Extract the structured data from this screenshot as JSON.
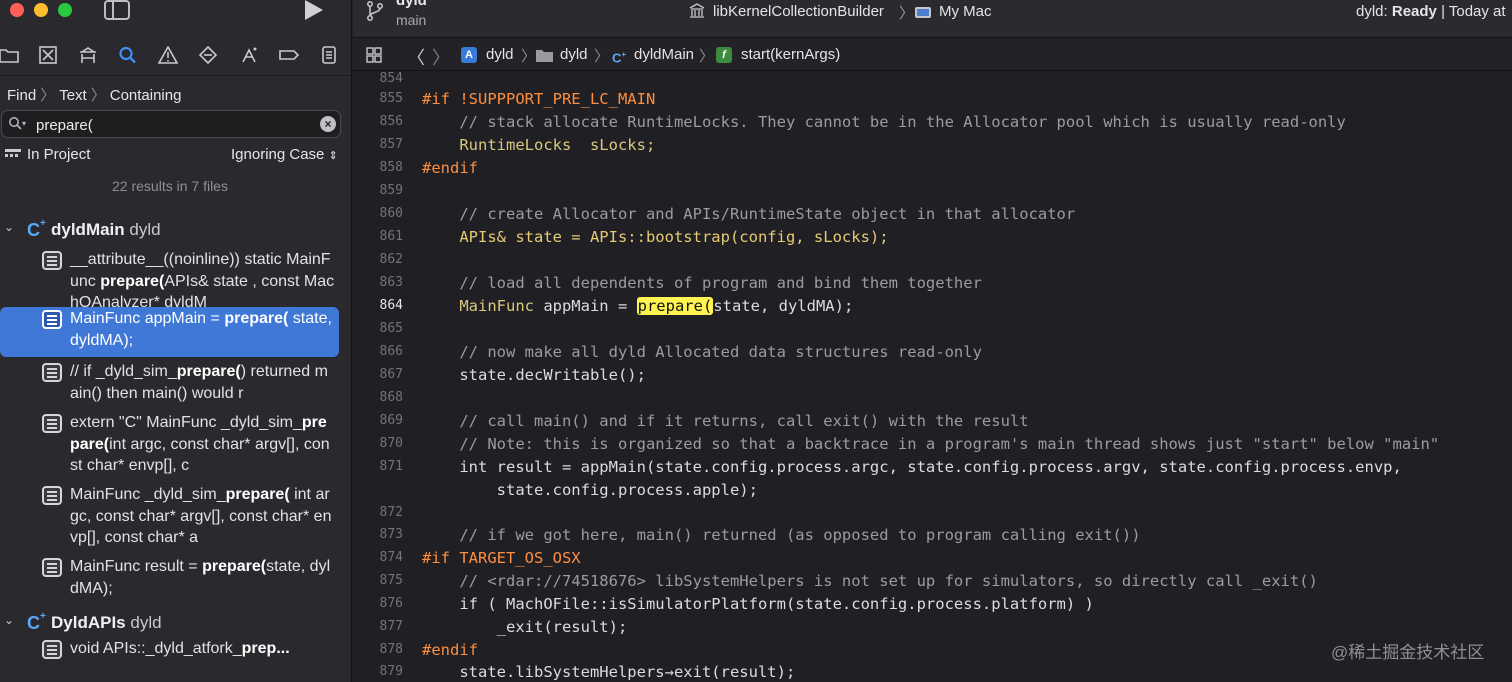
{
  "window": {
    "project": "dyld",
    "branch": "main",
    "scheme": "libKernelCollectionBuilder",
    "destination": "My Mac",
    "status_app": "dyld:",
    "status_state": "Ready",
    "status_suffix": "| Today at"
  },
  "navigator": {
    "icons": [
      "folder-icon",
      "source-control-icon",
      "symbol-icon",
      "find-icon",
      "issue-icon",
      "test-icon",
      "debug-icon",
      "breakpoint-icon",
      "report-icon"
    ],
    "active": "find-icon"
  },
  "find": {
    "breadcrumb": [
      "Find",
      "Text",
      "Containing"
    ],
    "query": "prepare(",
    "scope": "In Project",
    "case_mode": "Ignoring Case",
    "summary": "22 results in 7 files"
  },
  "results": {
    "group1": {
      "symbol": "dyldMain",
      "project": "dyld",
      "items": [
        {
          "pre": "__attribute__((noinline)) static MainFunc ",
          "match": "prepare(",
          "post": "APIs& state , const MachOAnalyzer* dyldM"
        },
        {
          "pre": "MainFunc appMain = ",
          "match": "prepare(",
          "post": " state, dyldMA);"
        },
        {
          "pre": "// if _dyld_sim_",
          "match": "prepare(",
          "post": ") returned main() then main() would r"
        },
        {
          "pre": "extern \"C\" MainFunc _dyld_sim_",
          "match": "prepare(",
          "post": "int argc, const char* argv[], const char* envp[], c"
        },
        {
          "pre": "MainFunc _dyld_sim_",
          "match": "prepare(",
          "post": " int argc, const char* argv[], const char* envp[], const char* a"
        },
        {
          "pre": "MainFunc result = ",
          "match": "prepare(",
          "post": "state, dyldMA);"
        }
      ]
    },
    "group2": {
      "symbol": "DyldAPIs",
      "project": "dyld",
      "items": [
        {
          "pre": "void APIs::_dyld_atfork_",
          "match": "prep...",
          "post": ""
        }
      ]
    }
  },
  "jumpbar": {
    "crumbs": [
      "dyld",
      "dyld",
      "dyldMain",
      "start(kernArgs)"
    ]
  },
  "editor": {
    "current_line": "864",
    "first_line_partial": "854",
    "lines": [
      {
        "n": "855",
        "t": "#if !SUPPPORT_PRE_LC_MAIN"
      },
      {
        "n": "856",
        "t": "    // stack allocate RuntimeLocks. They cannot be in the Allocator pool which is usually read-only"
      },
      {
        "n": "857",
        "t": "    RuntimeLocks  sLocks;"
      },
      {
        "n": "858",
        "t": "#endif"
      },
      {
        "n": "859",
        "t": ""
      },
      {
        "n": "860",
        "t": "    // create Allocator and APIs/RuntimeState object in that allocator"
      },
      {
        "n": "861",
        "t": "    APIs& state = APIs::bootstrap(config, sLocks);"
      },
      {
        "n": "862",
        "t": ""
      },
      {
        "n": "863",
        "t": "    // load all dependents of program and bind them together"
      },
      {
        "n": "864",
        "t": "    MainFunc appMain = prepare(state, dyldMA);"
      },
      {
        "n": "865",
        "t": ""
      },
      {
        "n": "866",
        "t": "    // now make all dyld Allocated data structures read-only"
      },
      {
        "n": "867",
        "t": "    state.decWritable();"
      },
      {
        "n": "868",
        "t": ""
      },
      {
        "n": "869",
        "t": "    // call main() and if it returns, call exit() with the result"
      },
      {
        "n": "870",
        "t": "    // Note: this is organized so that a backtrace in a program's main thread shows just \"start\" below \"main\""
      },
      {
        "n": "871",
        "t": "    int result = appMain(state.config.process.argc, state.config.process.argv, state.config.process.envp,"
      },
      {
        "n": "",
        "t": "        state.config.process.apple);"
      },
      {
        "n": "872",
        "t": ""
      },
      {
        "n": "873",
        "t": "    // if we got here, main() returned (as opposed to program calling exit())"
      },
      {
        "n": "874",
        "t": "#if TARGET_OS_OSX"
      },
      {
        "n": "875",
        "t": "    // <rdar://74518676> libSystemHelpers is not set up for simulators, so directly call _exit()"
      },
      {
        "n": "876",
        "t": "    if ( MachOFile::isSimulatorPlatform(state.config.process.platform) )"
      },
      {
        "n": "877",
        "t": "        _exit(result);"
      },
      {
        "n": "878",
        "t": "#endif"
      },
      {
        "n": "879",
        "t": "    state.libSystemHelpers→exit(result);"
      }
    ]
  },
  "watermark": "@稀土掘金技术社区"
}
